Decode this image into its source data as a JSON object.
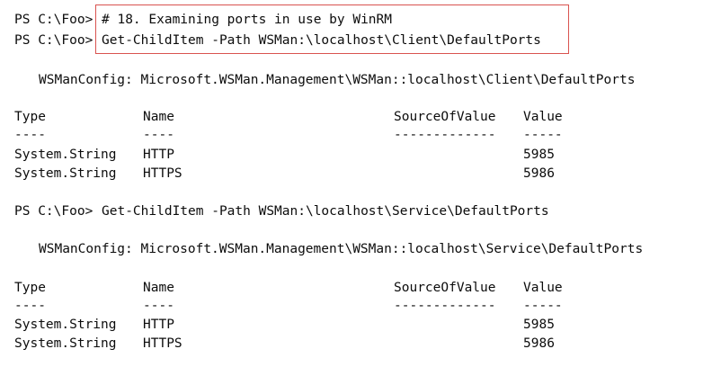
{
  "prompt": "PS C:\\Foo>",
  "block1": {
    "comment": "# 18. Examining ports in use by WinRM",
    "command": "Get-ChildItem -Path WSMan:\\localhost\\Client\\DefaultPorts",
    "config_line": "WSManConfig: Microsoft.WSMan.Management\\WSMan::localhost\\Client\\DefaultPorts",
    "headers": [
      "Type",
      "Name",
      "SourceOfValue",
      "Value"
    ],
    "underlines": [
      "----",
      "----",
      "-------------",
      "-----"
    ],
    "rows": [
      {
        "type": "System.String",
        "name": "HTTP",
        "source": "",
        "value": "5985"
      },
      {
        "type": "System.String",
        "name": "HTTPS",
        "source": "",
        "value": "5986"
      }
    ]
  },
  "block2": {
    "command": "Get-ChildItem -Path WSMan:\\localhost\\Service\\DefaultPorts",
    "config_line": "WSManConfig: Microsoft.WSMan.Management\\WSMan::localhost\\Service\\DefaultPorts",
    "headers": [
      "Type",
      "Name",
      "SourceOfValue",
      "Value"
    ],
    "underlines": [
      "----",
      "----",
      "-------------",
      "-----"
    ],
    "rows": [
      {
        "type": "System.String",
        "name": "HTTP",
        "source": "",
        "value": "5985"
      },
      {
        "type": "System.String",
        "name": "HTTPS",
        "source": "",
        "value": "5986"
      }
    ]
  },
  "colors": {
    "highlight_border": "#d9534f",
    "text": "#0c0c0c",
    "background": "#ffffff"
  }
}
